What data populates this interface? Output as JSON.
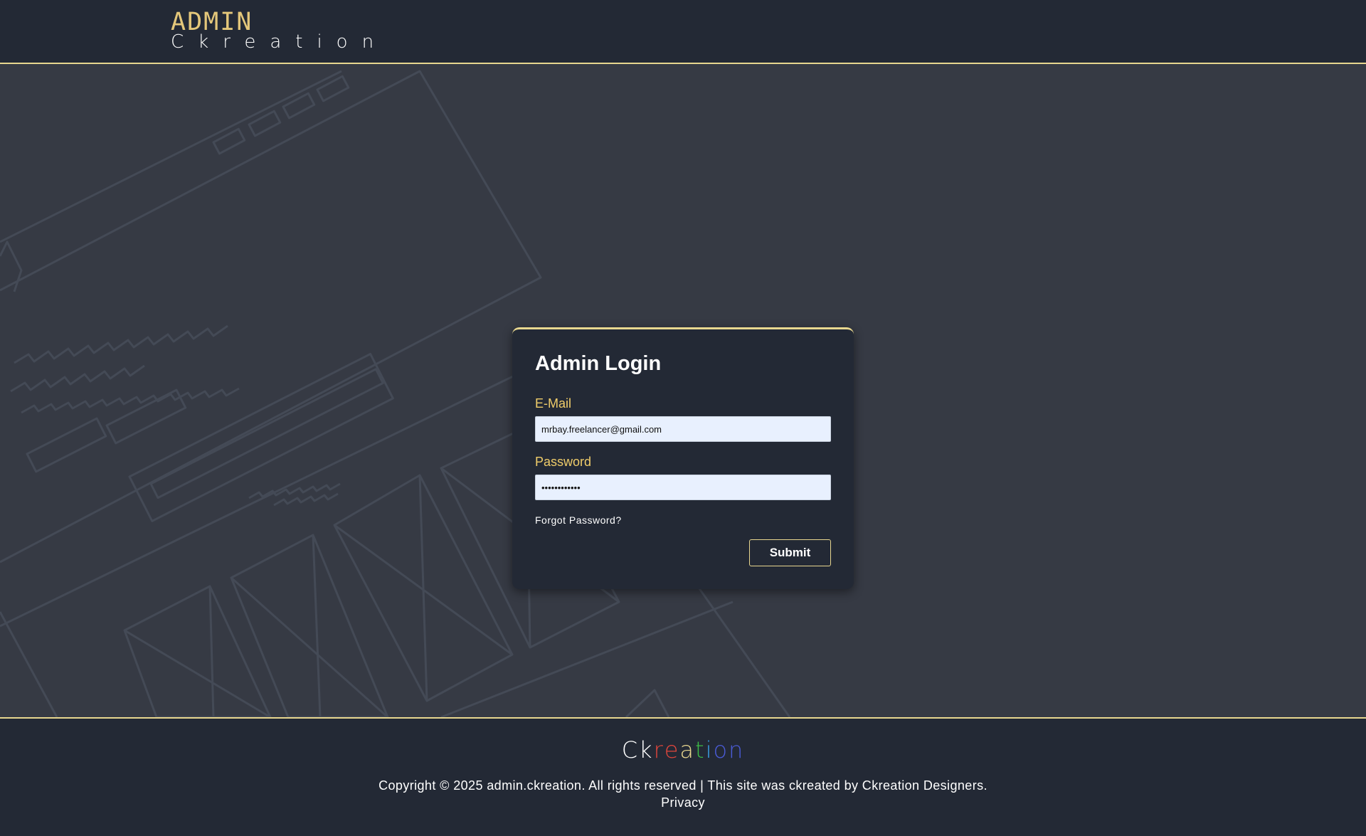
{
  "header": {
    "logo_admin": "ADMIN",
    "logo_sub": "Ckreation"
  },
  "login": {
    "title": "Admin Login",
    "email_label": "E-Mail",
    "email_value": "mrbay.freelancer@gmail.com",
    "password_label": "Password",
    "password_value": "••••••••••••",
    "forgot_label": "Forgot Password?",
    "submit_label": "Submit"
  },
  "footer": {
    "logo_letters": [
      {
        "char": "C",
        "color": "#ffffff"
      },
      {
        "char": "k",
        "color": "#ffffff"
      },
      {
        "char": "r",
        "color": "#e0463c"
      },
      {
        "char": "e",
        "color": "#e0463c"
      },
      {
        "char": "a",
        "color": "#e8d78f"
      },
      {
        "char": "t",
        "color": "#3dbb45"
      },
      {
        "char": "i",
        "color": "#3aa0e6"
      },
      {
        "char": "o",
        "color": "#4a5bd6"
      },
      {
        "char": "n",
        "color": "#4a5bd6"
      }
    ],
    "copyright": "Copyright © 2025 admin.ckreation. All rights reserved | This site was ckreated by Ckreation Designers.",
    "privacy_label": "Privacy"
  },
  "colors": {
    "accent": "#e8d78f",
    "label": "#f0cd6a",
    "background_dark": "#232935",
    "background_main": "#363a44"
  }
}
